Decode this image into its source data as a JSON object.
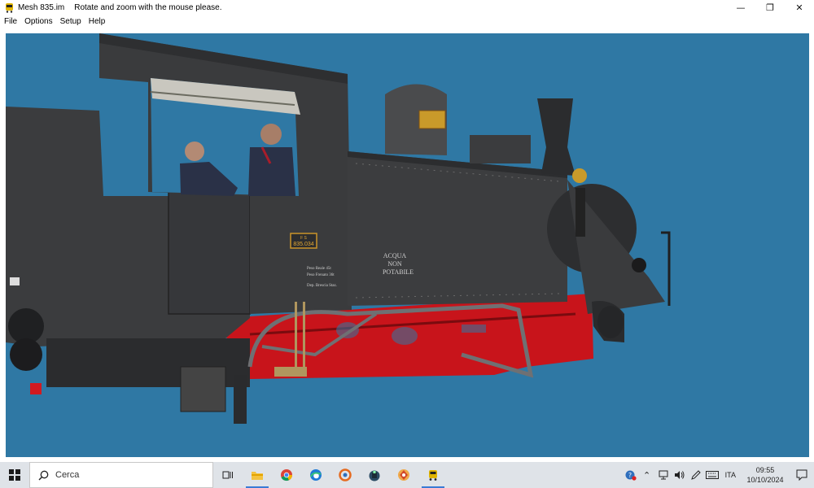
{
  "window": {
    "title": "Mesh 835.im",
    "hint": "Rotate and zoom with the mouse please.",
    "controls": {
      "minimize": "—",
      "restore": "❐",
      "close": "✕"
    }
  },
  "menu": [
    "File",
    "Options",
    "Setup",
    "Help"
  ],
  "scene": {
    "plate_top": "F S",
    "plate_number": "835.034",
    "tank_text": [
      "ACQUA",
      "NON",
      "POTABILE"
    ],
    "weight_text": [
      "Peso Reale  45t",
      "Peso Frenato 36t",
      "Dep. Brescia Staz."
    ],
    "colors": {
      "background": "#2f78a4",
      "body": "#3a3b3d",
      "frame": "#c8141b"
    }
  },
  "taskbar": {
    "search_placeholder": "Cerca",
    "icons": [
      "task-view-icon",
      "file-explorer-icon",
      "chrome-icon",
      "edge-icon",
      "app-icon-1",
      "app-icon-2",
      "app-icon-3",
      "app-icon-train"
    ],
    "language": "ITA",
    "time": "09:55",
    "date": "10/10/2024"
  }
}
